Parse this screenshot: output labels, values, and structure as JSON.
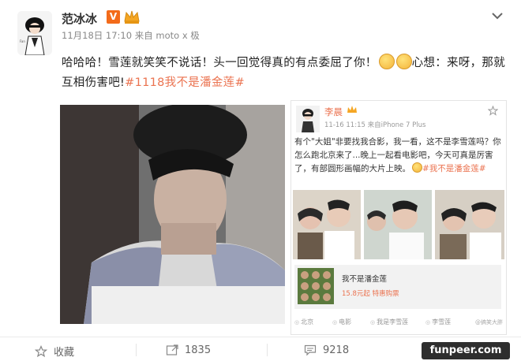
{
  "post": {
    "username": "范冰冰",
    "verified_badge": "V",
    "meta": "11月18日 17:10 来自 moto x 极",
    "text_main": "哈哈哈！雪莲就笑笑不说话！头一回觉得真的有点委屈了你！",
    "text_after_emoji": "心想：来呀，那就互相伤害吧!",
    "hashtag": "#1118我不是潘金莲#",
    "emoji_icons": [
      "laugh-emoji-icon",
      "laugh-emoji-icon"
    ]
  },
  "repost": {
    "username": "李晨",
    "meta": "11-16 11:15 来自iPhone 7 Plus",
    "text": "有个\"大姐\"非要找我合影，我一看，这不是李雪莲吗？你怎么跑北京来了...晚上一起看电影吧，今天可真是厉害了，有部圆形画幅的大片上映。",
    "hashtag": "#我不是潘金莲#",
    "card_title": "我不是潘金莲",
    "card_sub": "15.8元起 特惠购票",
    "tags": [
      "北京",
      "电影",
      "我是李雪莲",
      "李雪莲"
    ],
    "watermark": "@搞笑大胖"
  },
  "actions": {
    "favorite_label": "收藏",
    "repost_count": "1835",
    "comment_count": "9218"
  },
  "site_badge": "funpeer.com",
  "colors": {
    "link": "#eb7350",
    "badge": "#f36b1a"
  }
}
